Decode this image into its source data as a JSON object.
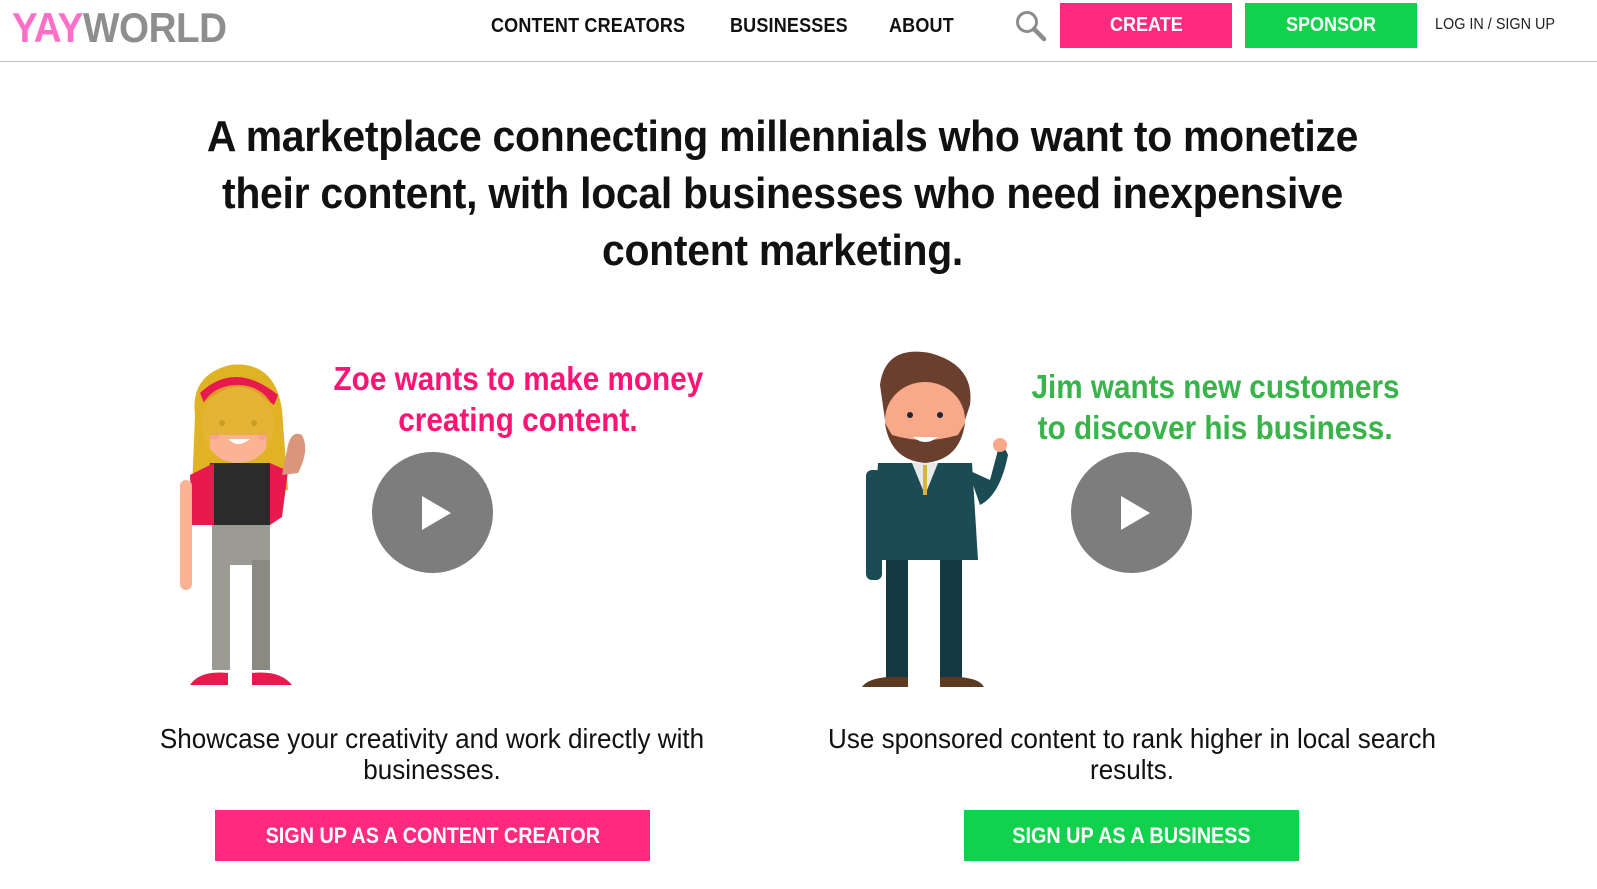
{
  "header": {
    "logo": {
      "part1": "YAY",
      "part2": "WORLD"
    },
    "nav": [
      {
        "label": "CONTENT CREATORS"
      },
      {
        "label": "BUSINESSES"
      },
      {
        "label": "ABOUT"
      }
    ],
    "search_icon": "search-icon",
    "create_label": "CREATE",
    "sponsor_label": "SPONSOR",
    "login_label": "LOG IN / SIGN UP"
  },
  "hero": {
    "headline": "A marketplace connecting millennials who want to monetize their content, with local businesses who need inexpensive content marketing."
  },
  "creator": {
    "video_title_line1": "Zoe wants to make money",
    "video_title_line2": "creating content.",
    "play_icon": "play-icon",
    "description": "Showcase your creativity and work directly with businesses.",
    "cta_label": "SIGN UP AS A CONTENT CREATOR"
  },
  "business": {
    "video_title_line1": "Jim wants new customers",
    "video_title_line2": "to discover his business.",
    "play_icon": "play-icon",
    "description": "Use sponsored content to rank higher in local search results.",
    "cta_label": "SIGN UP AS A BUSINESS"
  },
  "colors": {
    "pink": "#ff2a7f",
    "green": "#11d14d",
    "logo_pink": "#ff6fc9",
    "logo_gray": "#8e8e8e",
    "title_pink": "#ff1476",
    "title_green": "#38b44a",
    "play_gray": "#7d7d7d"
  }
}
